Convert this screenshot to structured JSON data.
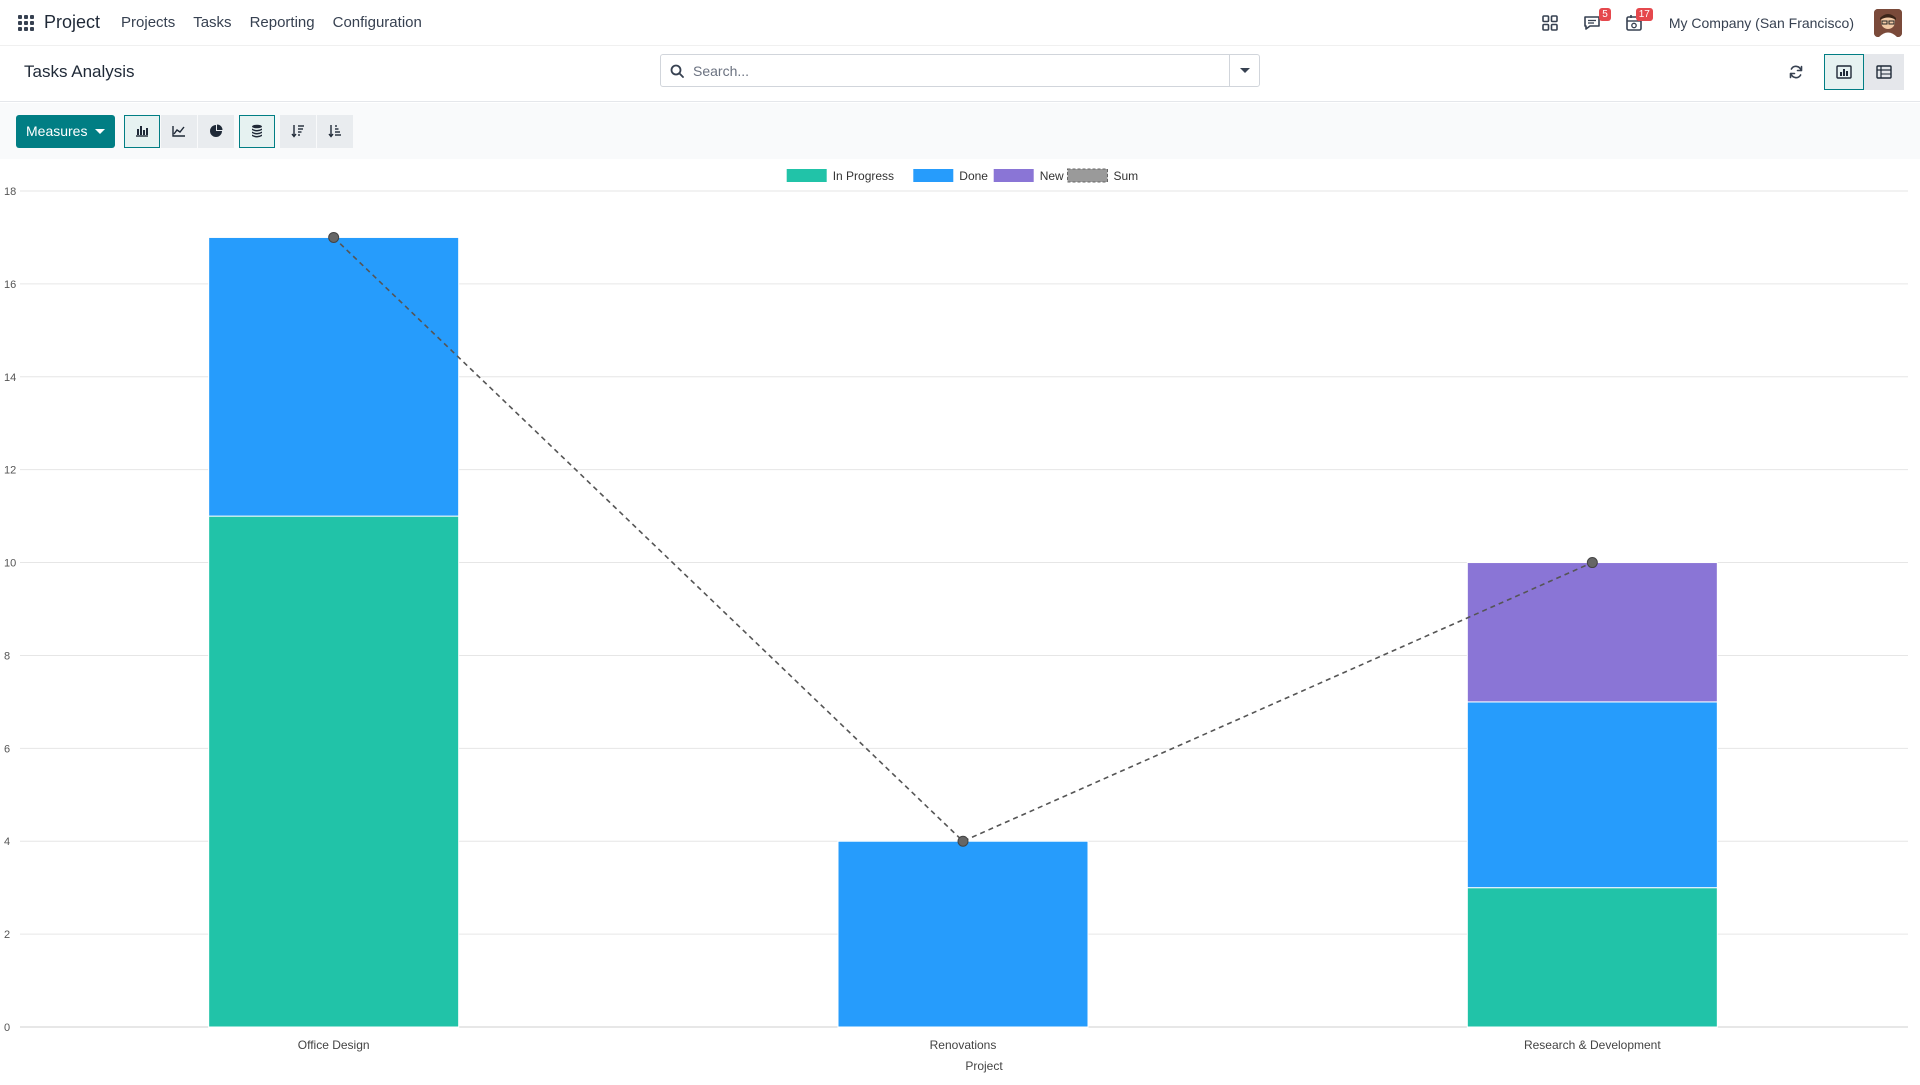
{
  "navbar": {
    "app_name": "Project",
    "menu": [
      "Projects",
      "Tasks",
      "Reporting",
      "Configuration"
    ],
    "messages_count": "5",
    "activities_count": "17",
    "company": "My Company (San Francisco)"
  },
  "control_panel": {
    "title": "Tasks Analysis",
    "search_placeholder": "Search..."
  },
  "toolbar": {
    "measures_label": "Measures"
  },
  "icons": {
    "apps": "apps-grid-icon",
    "search": "search-icon",
    "dropdown": "caret-down-icon",
    "refresh": "refresh-icon",
    "graph_view": "graph-view-icon",
    "pivot_view": "pivot-view-icon",
    "bar_chart": "bar-chart-icon",
    "line_chart": "line-chart-icon",
    "pie_chart": "pie-chart-icon",
    "stacked": "stacked-icon",
    "sort_desc": "sort-descending-icon",
    "sort_asc": "sort-ascending-icon"
  },
  "colors": {
    "accent": "#017e84",
    "in_progress": "#21c3a8",
    "done": "#269cfc",
    "new": "#8a75d6",
    "sum_line": "#555555"
  },
  "chart_data": {
    "type": "bar",
    "stacked": true,
    "categories": [
      "Office Design",
      "Renovations",
      "Research & Development"
    ],
    "series": [
      {
        "name": "In Progress",
        "values": [
          11,
          0,
          3
        ],
        "color": "#21c3a8"
      },
      {
        "name": "Done",
        "values": [
          6,
          4,
          4
        ],
        "color": "#269cfc"
      },
      {
        "name": "New",
        "values": [
          0,
          0,
          3
        ],
        "color": "#8a75d6"
      }
    ],
    "sum": {
      "name": "Sum",
      "values": [
        17,
        4,
        10
      ]
    },
    "xlabel": "Project",
    "ylabel": "",
    "ylim": [
      0,
      18
    ],
    "yticks": [
      0,
      2,
      4,
      6,
      8,
      10,
      12,
      14,
      16,
      18
    ],
    "grid": true,
    "legend_position": "top-center"
  }
}
